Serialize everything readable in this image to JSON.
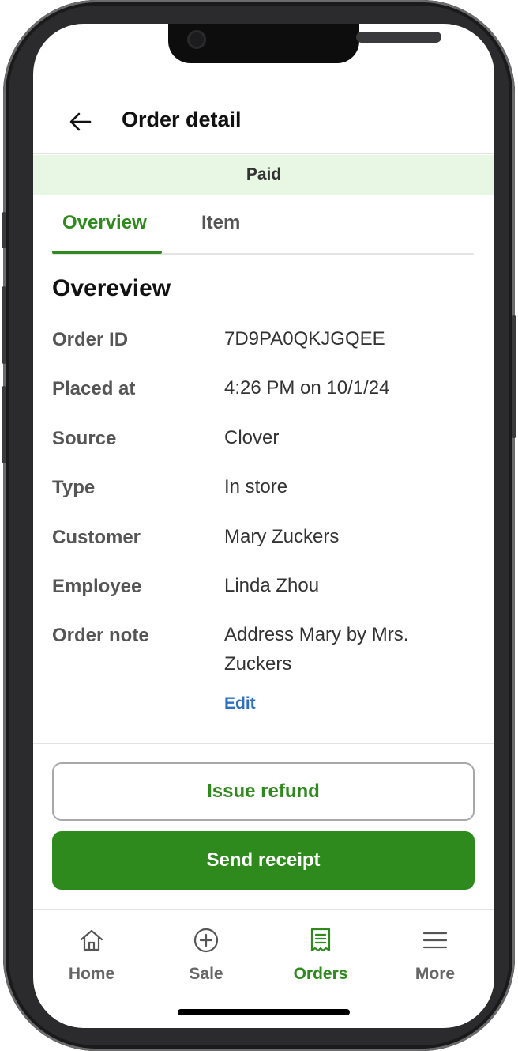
{
  "header": {
    "back_icon": "arrow-left-icon",
    "title": "Order detail"
  },
  "status_banner": {
    "text": "Paid",
    "color": "#e8f6e4"
  },
  "tabs": [
    {
      "label": "Overview",
      "active": true
    },
    {
      "label": "Item",
      "active": false
    }
  ],
  "overview": {
    "heading": "Overeview",
    "rows": [
      {
        "label": "Order ID",
        "value": "7D9PA0QKJGQEE"
      },
      {
        "label": "Placed at",
        "value": "4:26 PM on 10/1/24"
      },
      {
        "label": "Source",
        "value": "Clover"
      },
      {
        "label": "Type",
        "value": "In store"
      },
      {
        "label": "Customer",
        "value": "Mary Zuckers"
      },
      {
        "label": "Employee",
        "value": "Linda Zhou"
      },
      {
        "label": "Order note",
        "value": "Address Mary by Mrs. Zuckers"
      }
    ],
    "edit_label": "Edit"
  },
  "actions": {
    "refund_label": "Issue refund",
    "receipt_label": "Send receipt"
  },
  "bottom_nav": [
    {
      "label": "Home",
      "icon": "home-icon",
      "active": false
    },
    {
      "label": "Sale",
      "icon": "plus-circle-icon",
      "active": false
    },
    {
      "label": "Orders",
      "icon": "receipt-icon",
      "active": true
    },
    {
      "label": "More",
      "icon": "menu-icon",
      "active": false
    }
  ],
  "colors": {
    "accent": "#2e8a1d",
    "link": "#2f6fbd",
    "banner_bg": "#e8f6e4"
  }
}
